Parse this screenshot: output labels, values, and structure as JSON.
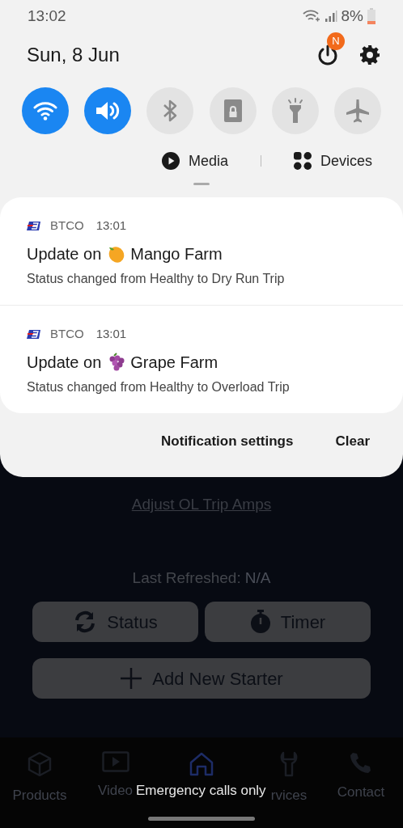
{
  "status_bar": {
    "time": "13:02",
    "battery": "8%"
  },
  "header": {
    "date": "Sun, 8 Jun",
    "power_badge": "N"
  },
  "quick_tiles": [
    {
      "kind": "wifi",
      "on": true
    },
    {
      "kind": "sound",
      "on": true
    },
    {
      "kind": "bluetooth",
      "on": false
    },
    {
      "kind": "lock",
      "on": false
    },
    {
      "kind": "flashlight",
      "on": false
    },
    {
      "kind": "airplane",
      "on": false
    }
  ],
  "shortcuts": [
    {
      "kind": "media",
      "label": "Media"
    },
    {
      "kind": "devices",
      "label": "Devices"
    }
  ],
  "notifications": [
    {
      "app": "BTCO",
      "time": "13:01",
      "title_prefix": "Update on",
      "kind": "mango",
      "subject": "Mango Farm",
      "body": "Status changed from Healthy to Dry Run Trip"
    },
    {
      "app": "BTCO",
      "time": "13:01",
      "title_prefix": "Update on",
      "kind": "grapes",
      "subject": "Grape Farm",
      "body": "Status changed from Healthy to Overload Trip"
    }
  ],
  "notification_actions": [
    "Notification settings",
    "Clear"
  ],
  "app": {
    "link": "Adjust OL Trip Amps",
    "last_refreshed_label": "Last Refreshed:",
    "last_refreshed_value": "N/A",
    "buttons": [
      {
        "kind": "refresh",
        "label": "Status"
      },
      {
        "kind": "timer",
        "label": "Timer"
      },
      {
        "kind": "plus",
        "label": "Add New Starter"
      }
    ],
    "nav": [
      {
        "kind": "box",
        "label": "Products",
        "selected": false
      },
      {
        "kind": "video",
        "label": "Video",
        "selected": false
      },
      {
        "kind": "home",
        "selected": true
      },
      {
        "kind": "wrench",
        "label": "rvices",
        "selected": false
      },
      {
        "kind": "phone",
        "label": "Contact",
        "selected": false
      }
    ]
  },
  "carrier_text": "Emergency calls only"
}
